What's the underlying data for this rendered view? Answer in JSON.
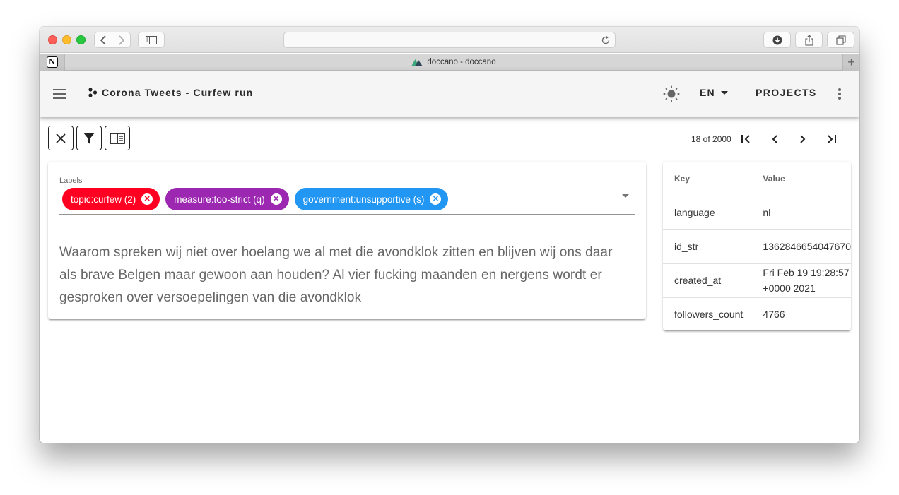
{
  "browser": {
    "tab_title": "doccano - doccano",
    "pinned_tab_icon": "notion-icon",
    "new_tab_label": "+"
  },
  "appbar": {
    "project_title": "Corona Tweets - Curfew run",
    "language": "EN",
    "projects_label": "PROJECTS"
  },
  "toolbar": {
    "pager_text": "18 of 2000"
  },
  "annotation": {
    "labels_caption": "Labels",
    "labels": [
      {
        "text": "topic:curfew (2)",
        "color": "#ff0022"
      },
      {
        "text": "measure:too-strict (q)",
        "color": "#9c27b0"
      },
      {
        "text": "government:unsupportive (s)",
        "color": "#2196f3"
      }
    ],
    "text": "Waarom spreken wij niet over hoelang we al met die avondklok zitten en blijven wij ons daar als brave Belgen maar gewoon aan houden? Al vier fucking maanden en nergens wordt er gesproken over versoepelingen van die avondklok"
  },
  "metadata": {
    "headers": {
      "key": "Key",
      "value": "Value"
    },
    "rows": [
      {
        "key": "language",
        "value": "nl"
      },
      {
        "key": "id_str",
        "value": "1362846654047670"
      },
      {
        "key": "created_at",
        "value": "Fri Feb 19 19:28:57 +0000 2021"
      },
      {
        "key": "followers_count",
        "value": "4766"
      }
    ]
  }
}
